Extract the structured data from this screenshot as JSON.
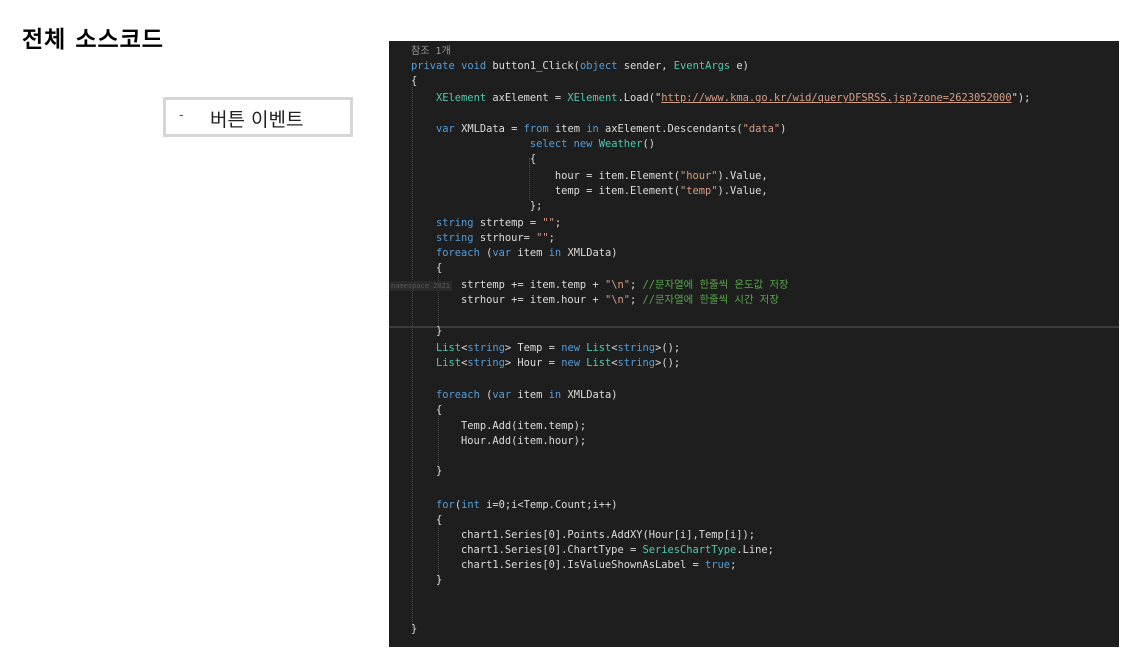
{
  "page": {
    "title": "전체 소스코드",
    "section_dash": "-",
    "section_label": "버튼 이벤트"
  },
  "editor": {
    "ghost_text": "namespace 2021",
    "colors": {
      "background": "#1e1e1e",
      "keyword": "#569cd6",
      "type": "#4ec9b0",
      "string": "#d69d85",
      "comment": "#57a64a",
      "text": "#dcdcdc"
    },
    "lines": [
      [
        {
          "t": "참조 1개",
          "c": "ref"
        }
      ],
      [
        {
          "t": "private",
          "c": "kw"
        },
        {
          "t": " ",
          "c": "tx"
        },
        {
          "t": "void",
          "c": "kw"
        },
        {
          "t": " button1_Click(",
          "c": "tx"
        },
        {
          "t": "object",
          "c": "kw"
        },
        {
          "t": " sender, ",
          "c": "tx"
        },
        {
          "t": "EventArgs",
          "c": "ty"
        },
        {
          "t": " e)",
          "c": "tx"
        }
      ],
      [
        {
          "t": "{",
          "c": "tx"
        }
      ],
      [
        {
          "t": "    ",
          "c": "tx"
        },
        {
          "t": "XElement",
          "c": "ty"
        },
        {
          "t": " axElement = ",
          "c": "tx"
        },
        {
          "t": "XElement",
          "c": "ty"
        },
        {
          "t": ".Load(\"",
          "c": "tx"
        },
        {
          "t": "http://www.kma.go.kr/wid/queryDFSRSS.jsp?zone=2623052000",
          "c": "url"
        },
        {
          "t": "\");",
          "c": "tx"
        }
      ],
      [
        {
          "t": "",
          "c": "tx"
        }
      ],
      [
        {
          "t": "    ",
          "c": "tx"
        },
        {
          "t": "var",
          "c": "kw"
        },
        {
          "t": " XMLData = ",
          "c": "tx"
        },
        {
          "t": "from",
          "c": "kw"
        },
        {
          "t": " item ",
          "c": "tx"
        },
        {
          "t": "in",
          "c": "kw"
        },
        {
          "t": " axElement.Descendants(",
          "c": "tx"
        },
        {
          "t": "\"data\"",
          "c": "st"
        },
        {
          "t": ")",
          "c": "tx"
        }
      ],
      [
        {
          "t": "                   ",
          "c": "tx"
        },
        {
          "t": "select",
          "c": "kw"
        },
        {
          "t": " ",
          "c": "tx"
        },
        {
          "t": "new",
          "c": "kw"
        },
        {
          "t": " ",
          "c": "tx"
        },
        {
          "t": "Weather",
          "c": "ty"
        },
        {
          "t": "()",
          "c": "tx"
        }
      ],
      [
        {
          "t": "                   {",
          "c": "tx"
        }
      ],
      [
        {
          "t": "                       hour = item.Element(",
          "c": "tx"
        },
        {
          "t": "\"hour\"",
          "c": "st"
        },
        {
          "t": ").Value,",
          "c": "tx"
        }
      ],
      [
        {
          "t": "                       temp = item.Element(",
          "c": "tx"
        },
        {
          "t": "\"temp\"",
          "c": "st"
        },
        {
          "t": ").Value,",
          "c": "tx"
        }
      ],
      [
        {
          "t": "                   };",
          "c": "tx"
        }
      ],
      [
        {
          "t": "    ",
          "c": "tx"
        },
        {
          "t": "string",
          "c": "kw"
        },
        {
          "t": " strtemp = ",
          "c": "tx"
        },
        {
          "t": "\"\"",
          "c": "st"
        },
        {
          "t": ";",
          "c": "tx"
        }
      ],
      [
        {
          "t": "    ",
          "c": "tx"
        },
        {
          "t": "string",
          "c": "kw"
        },
        {
          "t": " strhour= ",
          "c": "tx"
        },
        {
          "t": "\"\"",
          "c": "st"
        },
        {
          "t": ";",
          "c": "tx"
        }
      ],
      [
        {
          "t": "    ",
          "c": "tx"
        },
        {
          "t": "foreach",
          "c": "kw"
        },
        {
          "t": " (",
          "c": "tx"
        },
        {
          "t": "var",
          "c": "kw"
        },
        {
          "t": " item ",
          "c": "tx"
        },
        {
          "t": "in",
          "c": "kw"
        },
        {
          "t": " XMLData)",
          "c": "tx"
        }
      ],
      [
        {
          "t": "    {",
          "c": "tx"
        }
      ],
      [
        {
          "t": "        strtemp += item.temp + ",
          "c": "tx"
        },
        {
          "t": "\"\\n\"",
          "c": "st"
        },
        {
          "t": "; ",
          "c": "tx"
        },
        {
          "t": "//문자열에 한줄씩 온도값 저장",
          "c": "cm"
        }
      ],
      [
        {
          "t": "        strhour += item.hour + ",
          "c": "tx"
        },
        {
          "t": "\"\\n\"",
          "c": "st"
        },
        {
          "t": "; ",
          "c": "tx"
        },
        {
          "t": "//문자열에 한줄씩 시간 저장",
          "c": "cm"
        }
      ],
      [
        {
          "t": "",
          "c": "tx"
        }
      ],
      [
        {
          "t": "    }",
          "c": "tx"
        }
      ],
      [
        {
          "t": "    ",
          "c": "tx"
        },
        {
          "t": "List",
          "c": "ty"
        },
        {
          "t": "<",
          "c": "tx"
        },
        {
          "t": "string",
          "c": "kw"
        },
        {
          "t": "> Temp = ",
          "c": "tx"
        },
        {
          "t": "new",
          "c": "kw"
        },
        {
          "t": " ",
          "c": "tx"
        },
        {
          "t": "List",
          "c": "ty"
        },
        {
          "t": "<",
          "c": "tx"
        },
        {
          "t": "string",
          "c": "kw"
        },
        {
          "t": ">();",
          "c": "tx"
        }
      ],
      [
        {
          "t": "    ",
          "c": "tx"
        },
        {
          "t": "List",
          "c": "ty"
        },
        {
          "t": "<",
          "c": "tx"
        },
        {
          "t": "string",
          "c": "kw"
        },
        {
          "t": "> Hour = ",
          "c": "tx"
        },
        {
          "t": "new",
          "c": "kw"
        },
        {
          "t": " ",
          "c": "tx"
        },
        {
          "t": "List",
          "c": "ty"
        },
        {
          "t": "<",
          "c": "tx"
        },
        {
          "t": "string",
          "c": "kw"
        },
        {
          "t": ">();",
          "c": "tx"
        }
      ],
      [
        {
          "t": "",
          "c": "tx"
        }
      ],
      [
        {
          "t": "    ",
          "c": "tx"
        },
        {
          "t": "foreach",
          "c": "kw"
        },
        {
          "t": " (",
          "c": "tx"
        },
        {
          "t": "var",
          "c": "kw"
        },
        {
          "t": " item ",
          "c": "tx"
        },
        {
          "t": "in",
          "c": "kw"
        },
        {
          "t": " XMLData)",
          "c": "tx"
        }
      ],
      [
        {
          "t": "    {",
          "c": "tx"
        }
      ],
      [
        {
          "t": "        Temp.Add(item.temp);",
          "c": "tx"
        }
      ],
      [
        {
          "t": "        Hour.Add(item.hour);",
          "c": "tx"
        }
      ],
      [
        {
          "t": "",
          "c": "tx"
        }
      ],
      [
        {
          "t": "    }",
          "c": "tx"
        }
      ],
      [
        {
          "t": "",
          "c": "tx"
        }
      ],
      [
        {
          "t": "    ",
          "c": "tx"
        },
        {
          "t": "for",
          "c": "kw"
        },
        {
          "t": "(",
          "c": "tx"
        },
        {
          "t": "int",
          "c": "kw"
        },
        {
          "t": " i=0;i<Temp.Count;i++)",
          "c": "tx"
        }
      ],
      [
        {
          "t": "    {",
          "c": "tx"
        }
      ],
      [
        {
          "t": "        chart1.Series[0].Points.AddXY(Hour[i],Temp[i]);",
          "c": "tx"
        }
      ],
      [
        {
          "t": "        chart1.Series[0].ChartType = ",
          "c": "tx"
        },
        {
          "t": "SeriesChartType",
          "c": "ty"
        },
        {
          "t": ".Line;",
          "c": "tx"
        }
      ],
      [
        {
          "t": "        chart1.Series[0].IsValueShownAsLabel = ",
          "c": "tx"
        },
        {
          "t": "true",
          "c": "kw"
        },
        {
          "t": ";",
          "c": "tx"
        }
      ],
      [
        {
          "t": "    }",
          "c": "tx"
        }
      ],
      [
        {
          "t": "",
          "c": "tx"
        }
      ],
      [
        {
          "t": "",
          "c": "tx"
        }
      ],
      [
        {
          "t": "",
          "c": "tx"
        }
      ],
      [
        {
          "t": "}",
          "c": "tx"
        }
      ]
    ]
  }
}
